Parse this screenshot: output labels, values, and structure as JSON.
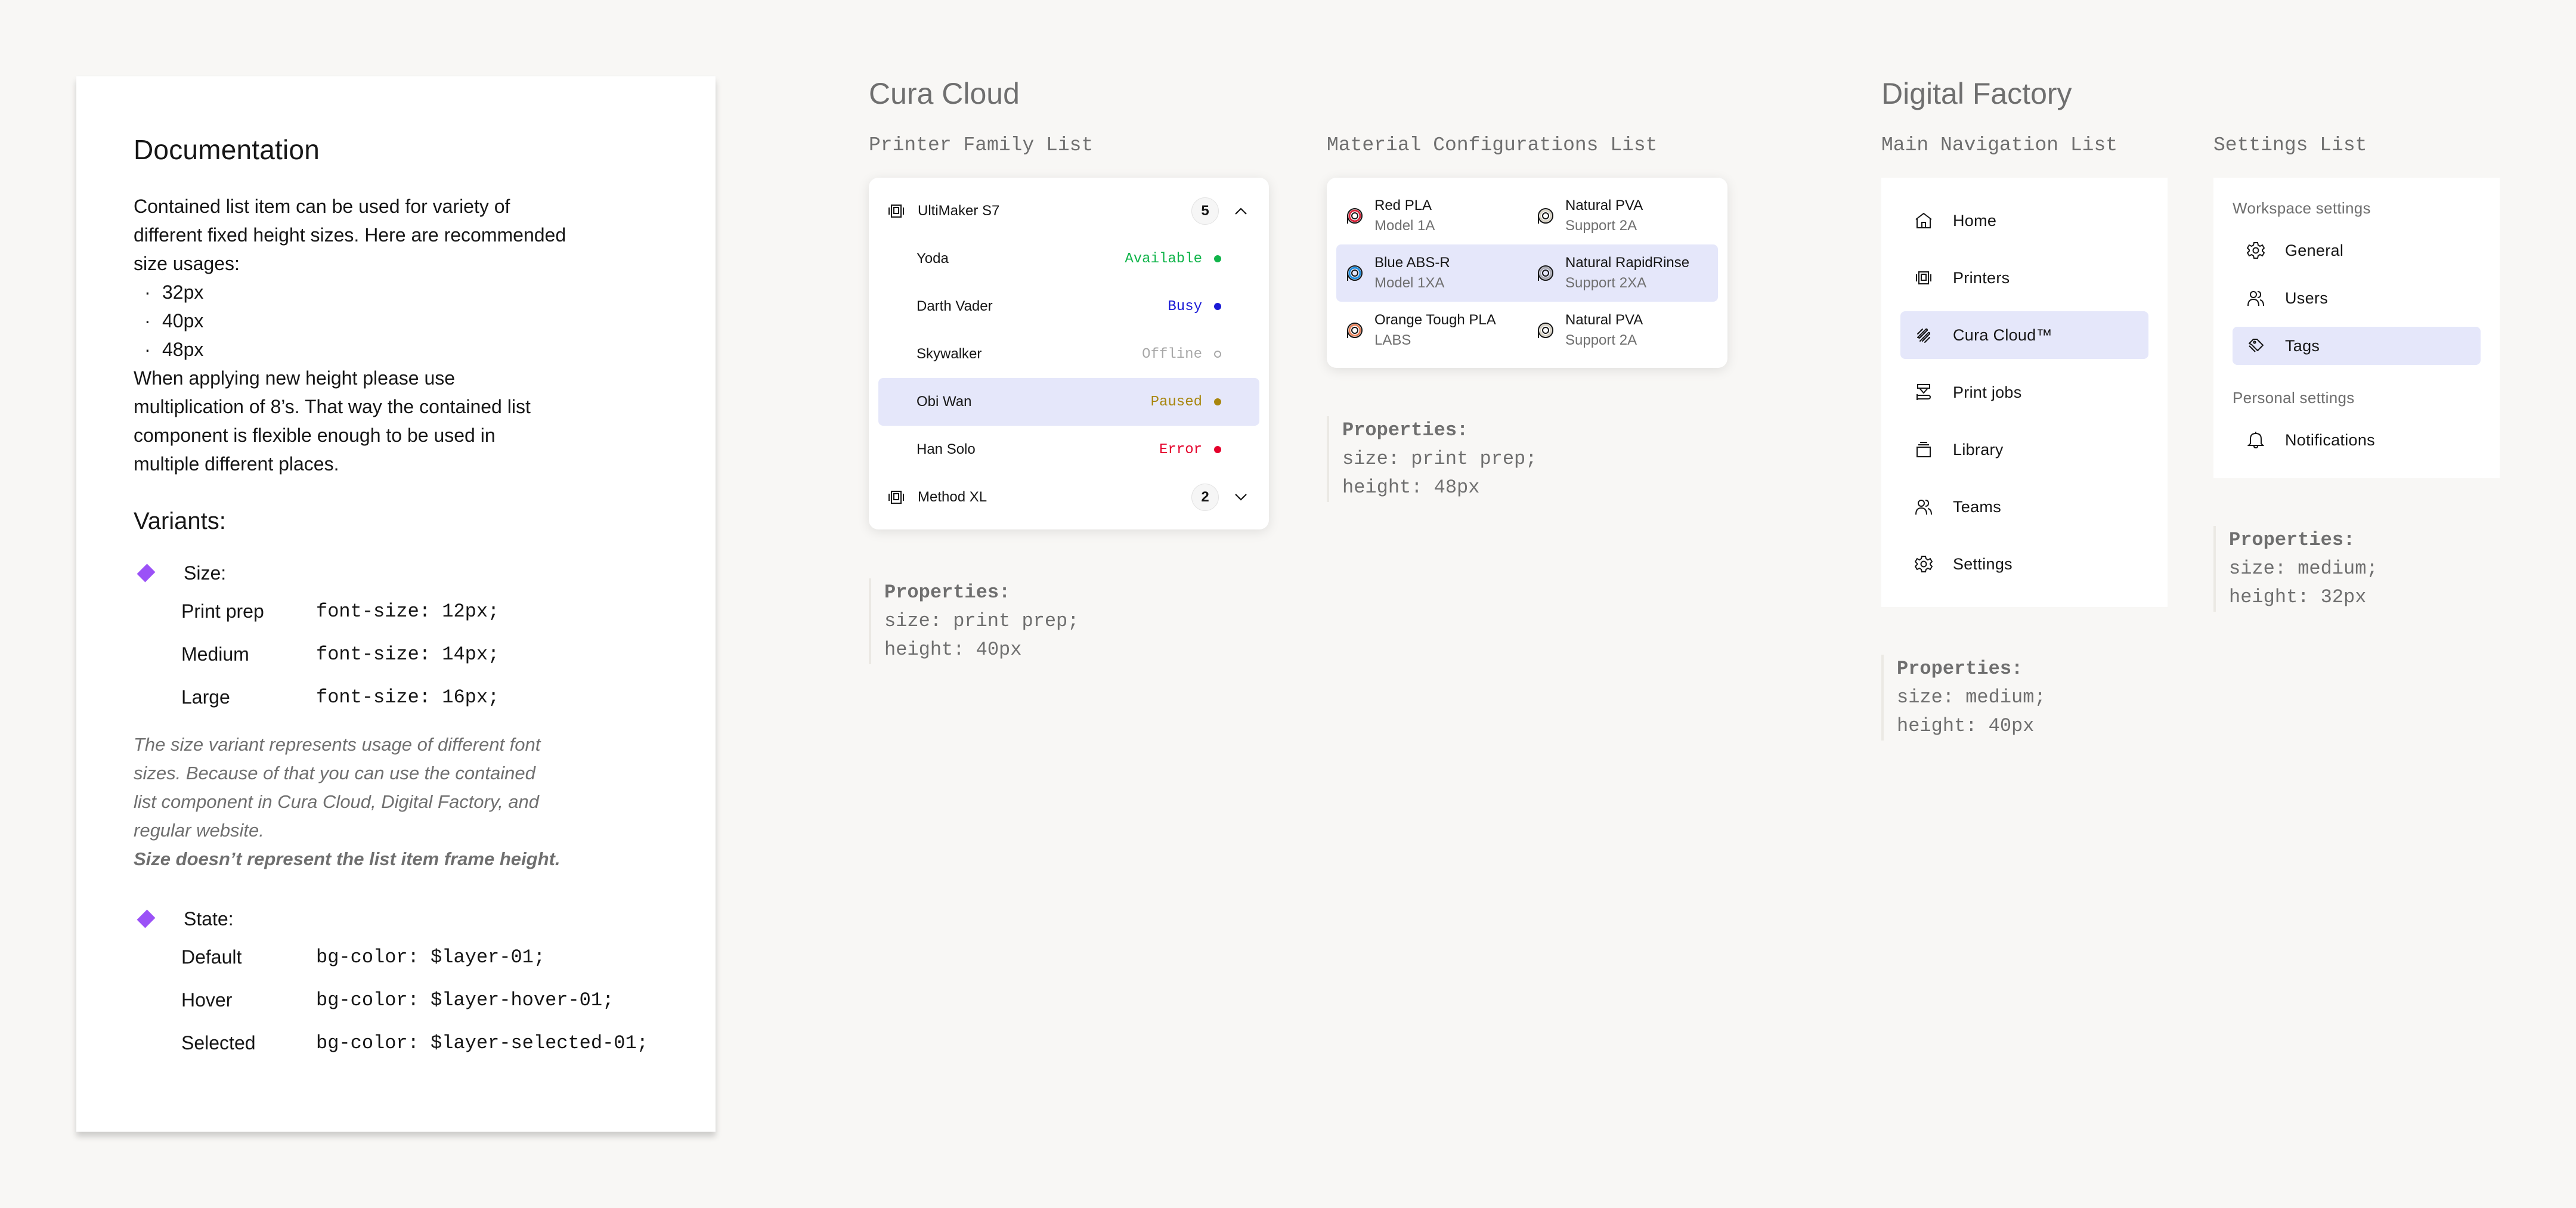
{
  "documentation": {
    "title": "Documentation",
    "intro_lines": [
      "Contained list item can be used for variety of",
      "different fixed height sizes. Here are recommended",
      "size usages:"
    ],
    "bullet_marker": "·",
    "sizes": [
      "32px",
      "40px",
      "48px"
    ],
    "guidance_lines": [
      "When applying new height please use",
      "multiplication of 8’s. That way the contained list",
      "component is flexible enough to be used in",
      "multiple different places."
    ],
    "variants_title": "Variants:",
    "accent_color": "#9b51f7",
    "size_variant": {
      "label": "Size:",
      "rows": [
        {
          "name": "Print prep",
          "value": "font-size: 12px;"
        },
        {
          "name": "Medium",
          "value": "font-size: 14px;"
        },
        {
          "name": "Large",
          "value": "font-size: 16px;"
        }
      ],
      "note_lines": [
        "The size variant represents usage of different font",
        "sizes. Because of that you can use the contained",
        "list component in Cura Cloud, Digital Factory, and",
        "regular website."
      ],
      "note_bold": "Size doesn’t represent the list item frame height."
    },
    "state_variant": {
      "label": "State:",
      "rows": [
        {
          "name": "Default",
          "value": "bg-color: $layer-01;"
        },
        {
          "name": "Hover",
          "value": "bg-color: $layer-hover-01;"
        },
        {
          "name": "Selected",
          "value": "bg-color: $layer-selected-01;"
        }
      ]
    }
  },
  "cura_cloud": {
    "title": "Cura Cloud",
    "printer_family_list": {
      "title": "Printer Family List",
      "groups": [
        {
          "name": "UltiMaker S7",
          "count": "5",
          "expanded": true,
          "printers": [
            {
              "name": "Yoda",
              "status": "Available",
              "color": "#10b44a",
              "filled": true
            },
            {
              "name": "Darth Vader",
              "status": "Busy",
              "color": "#1a1ad6",
              "filled": true
            },
            {
              "name": "Skywalker",
              "status": "Offline",
              "color": "#a8a8a8",
              "filled": false
            },
            {
              "name": "Obi Wan",
              "status": "Paused",
              "color": "#a8860e",
              "filled": true,
              "selected": true
            },
            {
              "name": "Han Solo",
              "status": "Error",
              "color": "#e4002b",
              "filled": true
            }
          ]
        },
        {
          "name": "Method XL",
          "count": "2",
          "expanded": false
        }
      ],
      "properties": {
        "heading": "Properties:",
        "size": "size: print prep;",
        "height": "height: 40px"
      }
    },
    "material_configurations_list": {
      "title": "Material Configurations List",
      "rows": [
        {
          "selected": false,
          "cells": [
            {
              "name": "Red PLA",
              "sub": "Model 1A",
              "color": "#d9263c"
            },
            {
              "name": "Natural PVA",
              "sub": "Support 2A",
              "color": "#d8d2c4"
            }
          ]
        },
        {
          "selected": true,
          "cells": [
            {
              "name": "Blue ABS-R",
              "sub": "Model 1XA",
              "color": "#1e8fe0"
            },
            {
              "name": "Natural RapidRinse",
              "sub": "Support 2XA",
              "color": "#a9a9b0"
            }
          ]
        },
        {
          "selected": false,
          "cells": [
            {
              "name": "Orange Tough PLA",
              "sub": "LABS",
              "color": "#e8825a"
            },
            {
              "name": "Natural PVA",
              "sub": "Support 2A",
              "color": "#d8d2c4"
            }
          ]
        }
      ],
      "properties": {
        "heading": "Properties:",
        "size": "size: print prep;",
        "height": "height: 48px"
      }
    }
  },
  "digital_factory": {
    "title": "Digital Factory",
    "main_navigation_list": {
      "title": "Main Navigation List",
      "items": [
        {
          "label": "Home",
          "icon": "home-icon"
        },
        {
          "label": "Printers",
          "icon": "printer-icon"
        },
        {
          "label": "Cura Cloud™",
          "icon": "cura-cloud-icon",
          "selected": true
        },
        {
          "label": "Print jobs",
          "icon": "print-job-icon"
        },
        {
          "label": "Library",
          "icon": "library-icon"
        },
        {
          "label": "Teams",
          "icon": "users-icon"
        },
        {
          "label": "Settings",
          "icon": "gear-icon"
        }
      ],
      "properties": {
        "heading": "Properties:",
        "size": "size: medium;",
        "height": "height: 40px"
      }
    },
    "settings_list": {
      "title": "Settings List",
      "groups": [
        {
          "label": "Workspace settings",
          "items": [
            {
              "label": "General",
              "icon": "gear-icon"
            },
            {
              "label": "Users",
              "icon": "users-icon"
            },
            {
              "label": "Tags",
              "icon": "tag-icon",
              "selected": true
            }
          ]
        },
        {
          "label": "Personal settings",
          "items": [
            {
              "label": "Notifications",
              "icon": "bell-icon"
            }
          ]
        }
      ],
      "properties": {
        "heading": "Properties:",
        "size": "size: medium;",
        "height": "height: 32px"
      }
    }
  },
  "colors": {
    "page_background": "#f8f7f5",
    "selected_background": "#e5e7fa",
    "muted_text": "#6f6f6f"
  }
}
